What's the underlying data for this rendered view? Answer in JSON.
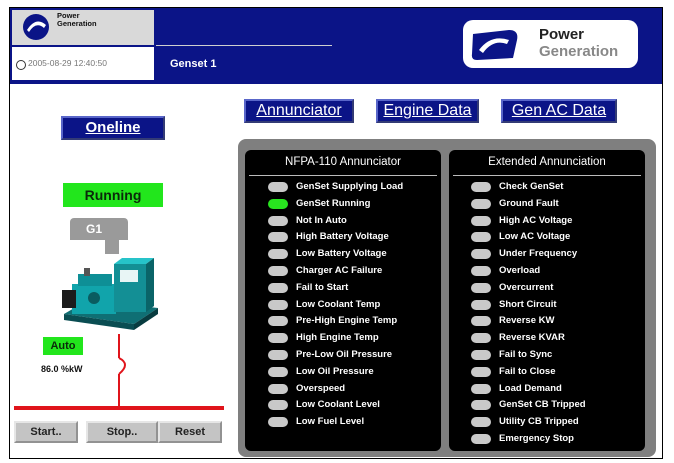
{
  "header": {
    "small_logo_text": "Power\nGeneration",
    "timestamp": "2005-08-29 12:40:50",
    "genset_name": "Genset 1",
    "brand_line1": "Power",
    "brand_line2": "Generation",
    "brand_color": "#0b1487"
  },
  "nav": {
    "oneline": "Oneline",
    "annunciator": "Annunciator",
    "engine_data": "Engine Data",
    "gen_ac_data": "Gen AC Data"
  },
  "genset": {
    "status": "Running",
    "label": "G1",
    "mode": "Auto",
    "power": "86.0  %kW",
    "status_color": "#22e61c"
  },
  "controls": {
    "start": "Start..",
    "stop": "Stop..",
    "reset": "Reset"
  },
  "annunciator": {
    "nfpa_title": "NFPA-110 Annunciator",
    "nfpa_items": [
      {
        "label": "GenSet Supplying Load",
        "on": false
      },
      {
        "label": "GenSet Running",
        "on": true
      },
      {
        "label": "Not In Auto",
        "on": false
      },
      {
        "label": "High Battery Voltage",
        "on": false
      },
      {
        "label": "Low Battery Voltage",
        "on": false
      },
      {
        "label": "Charger AC Failure",
        "on": false
      },
      {
        "label": "Fail to Start",
        "on": false
      },
      {
        "label": "Low Coolant Temp",
        "on": false
      },
      {
        "label": "Pre-High Engine Temp",
        "on": false
      },
      {
        "label": "High Engine Temp",
        "on": false
      },
      {
        "label": "Pre-Low Oil Pressure",
        "on": false
      },
      {
        "label": "Low Oil Pressure",
        "on": false
      },
      {
        "label": "Overspeed",
        "on": false
      },
      {
        "label": "Low Coolant Level",
        "on": false
      },
      {
        "label": "Low Fuel Level",
        "on": false
      }
    ],
    "extended_title": "Extended Annunciation",
    "extended_items": [
      {
        "label": "Check GenSet",
        "on": false
      },
      {
        "label": "Ground Fault",
        "on": false
      },
      {
        "label": "High AC Voltage",
        "on": false
      },
      {
        "label": "Low AC Voltage",
        "on": false
      },
      {
        "label": "Under Frequency",
        "on": false
      },
      {
        "label": "Overload",
        "on": false
      },
      {
        "label": "Overcurrent",
        "on": false
      },
      {
        "label": "Short Circuit",
        "on": false
      },
      {
        "label": "Reverse KW",
        "on": false
      },
      {
        "label": "Reverse KVAR",
        "on": false
      },
      {
        "label": "Fail to Sync",
        "on": false
      },
      {
        "label": "Fail to Close",
        "on": false
      },
      {
        "label": "Load Demand",
        "on": false
      },
      {
        "label": "GenSet CB Tripped",
        "on": false
      },
      {
        "label": "Utility CB Tripped",
        "on": false
      },
      {
        "label": "Emergency Stop",
        "on": false
      }
    ],
    "led_on_color": "#28e41f",
    "led_off_color": "#c9c9c9"
  }
}
